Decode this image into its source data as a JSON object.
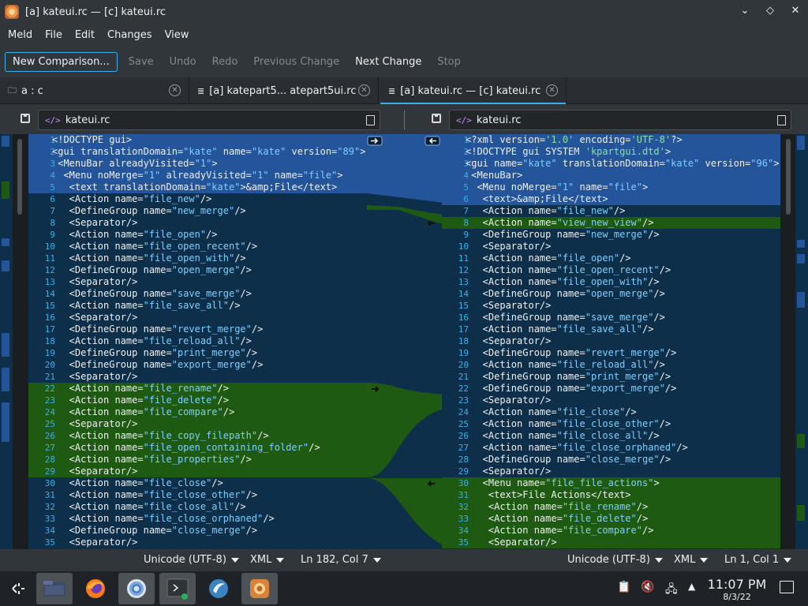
{
  "window": {
    "title": "[a] kateui.rc — [c] kateui.rc"
  },
  "menubar": [
    "Meld",
    "File",
    "Edit",
    "Changes",
    "View"
  ],
  "toolbar": {
    "new_comparison": "New Comparison...",
    "save": "Save",
    "undo": "Undo",
    "redo": "Redo",
    "previous_change": "Previous Change",
    "next_change": "Next Change",
    "stop": "Stop"
  },
  "tabs": [
    {
      "label": "a : c",
      "icon": "folder-icon"
    },
    {
      "label": "[a] katepart5... atepart5ui.rc",
      "icon": "document-icon"
    },
    {
      "label": "[a] kateui.rc — [c] kateui.rc",
      "icon": "document-icon",
      "active": true
    }
  ],
  "files": {
    "left": {
      "name": "kateui.rc"
    },
    "right": {
      "name": "kateui.rc"
    }
  },
  "left_lines": [
    {
      "n": "1",
      "t": "<!DOCTYPE gui>",
      "g": "chg"
    },
    {
      "n": "2",
      "t": "<gui translationDomain=\"kate\" name=\"kate\" version=\"89\">",
      "g": "chg"
    },
    {
      "n": "3",
      "t": " <MenuBar alreadyVisited=\"1\">",
      "g": "chg"
    },
    {
      "n": "4",
      "t": "  <Menu noMerge=\"1\" alreadyVisited=\"1\" name=\"file\">",
      "g": "chg"
    },
    {
      "n": "5",
      "t": "   <text translationDomain=\"kate\">&amp;File</text>",
      "g": "chg"
    },
    {
      "n": "6",
      "t": "   <Action name=\"file_new\"/>",
      "g": ""
    },
    {
      "n": "7",
      "t": "   <DefineGroup name=\"new_merge\"/>",
      "g": ""
    },
    {
      "n": "8",
      "t": "   <Separator/>",
      "g": ""
    },
    {
      "n": "9",
      "t": "   <Action name=\"file_open\"/>",
      "g": ""
    },
    {
      "n": "10",
      "t": "   <Action name=\"file_open_recent\"/>",
      "g": ""
    },
    {
      "n": "11",
      "t": "   <Action name=\"file_open_with\"/>",
      "g": ""
    },
    {
      "n": "12",
      "t": "   <DefineGroup name=\"open_merge\"/>",
      "g": ""
    },
    {
      "n": "13",
      "t": "   <Separator/>",
      "g": ""
    },
    {
      "n": "14",
      "t": "   <DefineGroup name=\"save_merge\"/>",
      "g": ""
    },
    {
      "n": "15",
      "t": "   <Action name=\"file_save_all\"/>",
      "g": ""
    },
    {
      "n": "16",
      "t": "   <Separator/>",
      "g": ""
    },
    {
      "n": "17",
      "t": "   <DefineGroup name=\"revert_merge\"/>",
      "g": ""
    },
    {
      "n": "18",
      "t": "   <Action name=\"file_reload_all\"/>",
      "g": ""
    },
    {
      "n": "19",
      "t": "   <DefineGroup name=\"print_merge\"/>",
      "g": ""
    },
    {
      "n": "20",
      "t": "   <DefineGroup name=\"export_merge\"/>",
      "g": ""
    },
    {
      "n": "21",
      "t": "   <Separator/>",
      "g": ""
    },
    {
      "n": "22",
      "t": "   <Action name=\"file_rename\"/>",
      "g": "ins"
    },
    {
      "n": "23",
      "t": "   <Action name=\"file_delete\"/>",
      "g": "ins"
    },
    {
      "n": "24",
      "t": "   <Action name=\"file_compare\"/>",
      "g": "ins"
    },
    {
      "n": "25",
      "t": "   <Separator/>",
      "g": "ins"
    },
    {
      "n": "26",
      "t": "   <Action name=\"file_copy_filepath\"/>",
      "g": "ins"
    },
    {
      "n": "27",
      "t": "   <Action name=\"file_open_containing_folder\"/>",
      "g": "ins"
    },
    {
      "n": "28",
      "t": "   <Action name=\"file_properties\"/>",
      "g": "ins"
    },
    {
      "n": "29",
      "t": "   <Separator/>",
      "g": "ins"
    },
    {
      "n": "30",
      "t": "   <Action name=\"file_close\"/>",
      "g": ""
    },
    {
      "n": "31",
      "t": "   <Action name=\"file_close_other\"/>",
      "g": ""
    },
    {
      "n": "32",
      "t": "   <Action name=\"file_close_all\"/>",
      "g": ""
    },
    {
      "n": "33",
      "t": "   <Action name=\"file_close_orphaned\"/>",
      "g": ""
    },
    {
      "n": "34",
      "t": "   <DefineGroup name=\"close_merge\"/>",
      "g": ""
    },
    {
      "n": "35",
      "t": "   <Separator/>",
      "g": ""
    }
  ],
  "right_lines": [
    {
      "n": "1",
      "t": "<?xml version='1.0' encoding='UTF-8'?>",
      "g": "chg"
    },
    {
      "n": "2",
      "t": "<!DOCTYPE gui SYSTEM 'kpartgui.dtd'>",
      "g": "chg"
    },
    {
      "n": "3",
      "t": "<gui name=\"kate\" translationDomain=\"kate\" version=\"96\">",
      "g": "chg"
    },
    {
      "n": "4",
      "t": " <MenuBar>",
      "g": "chg"
    },
    {
      "n": "5",
      "t": "  <Menu noMerge=\"1\" name=\"file\">",
      "g": "chg"
    },
    {
      "n": "6",
      "t": "   <text>&amp;File</text>",
      "g": "chg"
    },
    {
      "n": "7",
      "t": "   <Action name=\"file_new\"/>",
      "g": ""
    },
    {
      "n": "8",
      "t": "   <Action name=\"view_new_view\"/>",
      "g": "ins"
    },
    {
      "n": "9",
      "t": "   <DefineGroup name=\"new_merge\"/>",
      "g": ""
    },
    {
      "n": "10",
      "t": "   <Separator/>",
      "g": ""
    },
    {
      "n": "11",
      "t": "   <Action name=\"file_open\"/>",
      "g": ""
    },
    {
      "n": "12",
      "t": "   <Action name=\"file_open_recent\"/>",
      "g": ""
    },
    {
      "n": "13",
      "t": "   <Action name=\"file_open_with\"/>",
      "g": ""
    },
    {
      "n": "14",
      "t": "   <DefineGroup name=\"open_merge\"/>",
      "g": ""
    },
    {
      "n": "15",
      "t": "   <Separator/>",
      "g": ""
    },
    {
      "n": "16",
      "t": "   <DefineGroup name=\"save_merge\"/>",
      "g": ""
    },
    {
      "n": "17",
      "t": "   <Action name=\"file_save_all\"/>",
      "g": ""
    },
    {
      "n": "18",
      "t": "   <Separator/>",
      "g": ""
    },
    {
      "n": "19",
      "t": "   <DefineGroup name=\"revert_merge\"/>",
      "g": ""
    },
    {
      "n": "20",
      "t": "   <Action name=\"file_reload_all\"/>",
      "g": ""
    },
    {
      "n": "21",
      "t": "   <DefineGroup name=\"print_merge\"/>",
      "g": ""
    },
    {
      "n": "22",
      "t": "   <DefineGroup name=\"export_merge\"/>",
      "g": ""
    },
    {
      "n": "23",
      "t": "   <Separator/>",
      "g": ""
    },
    {
      "n": "24",
      "t": "   <Action name=\"file_close\"/>",
      "g": ""
    },
    {
      "n": "25",
      "t": "   <Action name=\"file_close_other\"/>",
      "g": ""
    },
    {
      "n": "26",
      "t": "   <Action name=\"file_close_all\"/>",
      "g": ""
    },
    {
      "n": "27",
      "t": "   <Action name=\"file_close_orphaned\"/>",
      "g": ""
    },
    {
      "n": "28",
      "t": "   <DefineGroup name=\"close_merge\"/>",
      "g": ""
    },
    {
      "n": "29",
      "t": "   <Separator/>",
      "g": ""
    },
    {
      "n": "30",
      "t": "   <Menu name=\"file_file_actions\">",
      "g": "ins"
    },
    {
      "n": "31",
      "t": "    <text>File Actions</text>",
      "g": "ins"
    },
    {
      "n": "32",
      "t": "    <Action name=\"file_rename\"/>",
      "g": "ins"
    },
    {
      "n": "33",
      "t": "    <Action name=\"file_delete\"/>",
      "g": "ins"
    },
    {
      "n": "34",
      "t": "    <Action name=\"file_compare\"/>",
      "g": "ins"
    },
    {
      "n": "35",
      "t": "    <Separator/>",
      "g": "ins"
    }
  ],
  "status": {
    "left": {
      "encoding": "Unicode (UTF-8)",
      "language": "XML",
      "position": "Ln 182, Col 7"
    },
    "right": {
      "encoding": "Unicode (UTF-8)",
      "language": "XML",
      "position": "Ln 1, Col 1"
    }
  },
  "taskbar": {
    "apps": [
      "application-launcher-icon",
      "file-manager-icon",
      "firefox-icon",
      "chromium-icon",
      "terminal-icon",
      "krita-icon",
      "meld-icon"
    ],
    "time": "11:07 PM",
    "date": "8/3/22"
  },
  "colors": {
    "changed": "#24549a",
    "inserted": "#1f5a12",
    "background": "#0e2f4a",
    "accent": "#3daee9"
  }
}
